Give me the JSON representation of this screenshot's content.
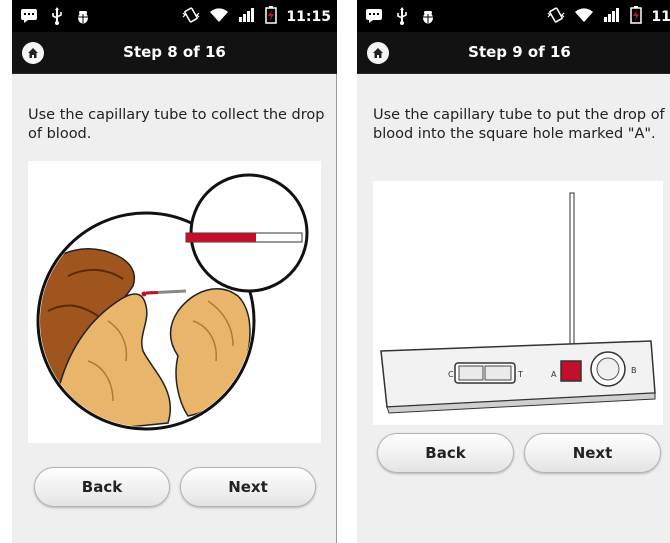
{
  "status_bar": {
    "time": "11:15",
    "icons": [
      "chat-icon",
      "usb-icon",
      "debug-icon",
      "vibrate-icon",
      "wifi-icon",
      "signal-icon",
      "battery-charging-icon"
    ]
  },
  "screens": [
    {
      "title": "Step 8 of 16",
      "instruction": "Use the capillary tube to collect the drop of blood.",
      "back_label": "Back",
      "next_label": "Next"
    },
    {
      "title": "Step 9 of 16",
      "instruction": "Use the capillary tube to put the drop of blood into the square hole marked \"A\".",
      "back_label": "Back",
      "next_label": "Next"
    }
  ],
  "test_cassette": {
    "label_c": "C",
    "label_t": "T",
    "label_a": "A",
    "label_b": "B"
  },
  "colors": {
    "status_bar": "#000000",
    "title_bar": "#121212",
    "background": "#efefef",
    "blood": "#c0102a"
  }
}
